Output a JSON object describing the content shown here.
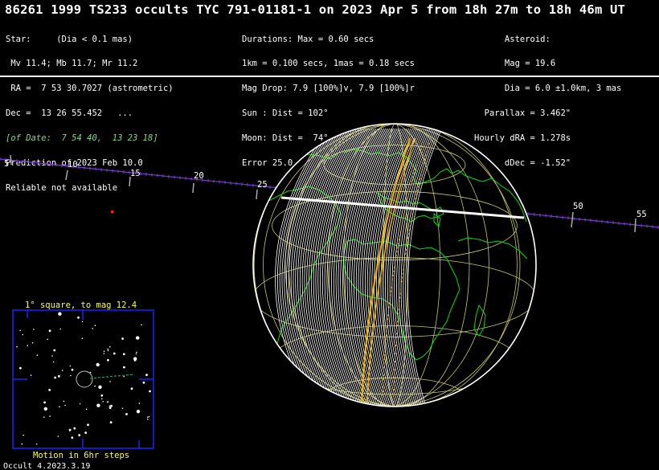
{
  "title": "86261 1999 TS233 occults TYC 791-01181-1 on 2023 Apr  5 from 18h 27m to 18h 46m UT",
  "star": {
    "lines": [
      "Star:     (Dia < 0.1 mas)",
      " Mv 11.4; Mb 11.7; Mr 11.2",
      " RA =  7 53 30.7027 (astrometric)",
      "Dec =  13 26 55.452   ...",
      "[of Date:  7 54 40,  13 23 18]",
      "Prediction of 2023 Feb 10.0",
      "Reliable not available"
    ]
  },
  "event": {
    "lines": [
      "Durations: Max = 0.60 secs",
      "1km = 0.100 secs, 1mas = 0.18 secs",
      "Mag Drop: 7.9 [100%]v, 7.9 [100%]r",
      "Sun : Dist = 102°",
      "Moon: Dist =  74°, illum =100%",
      "Error 25.0 x 14.0 mas in PA 111°"
    ]
  },
  "asteroid": {
    "lines": [
      "      Asteroid:",
      "      Mag = 19.6",
      "      Dia = 6.0 ±1.0km, 3 mas",
      "  Parallax = 3.462\"",
      "Hourly dRA = 1.278s",
      "      dDec = -1.52\""
    ]
  },
  "track": {
    "tick_labels": [
      "5",
      "10",
      "15",
      "20",
      "25",
      "50",
      "55"
    ]
  },
  "inset": {
    "title": "1° square, to mag 12.4",
    "footer": "Motion in 6hr steps"
  },
  "footer": {
    "version": "Occult 4.2023.3.19"
  },
  "colors": {
    "background": "#000000",
    "text": "#ffffff",
    "globe_grid": "#c8c864",
    "coastline": "#00e000",
    "path_band": "#ffffff",
    "path_edge": "#f0b000",
    "track": "#7a3ccf",
    "inset_frame": "#2020ff",
    "inset_text": "#ffff40"
  }
}
